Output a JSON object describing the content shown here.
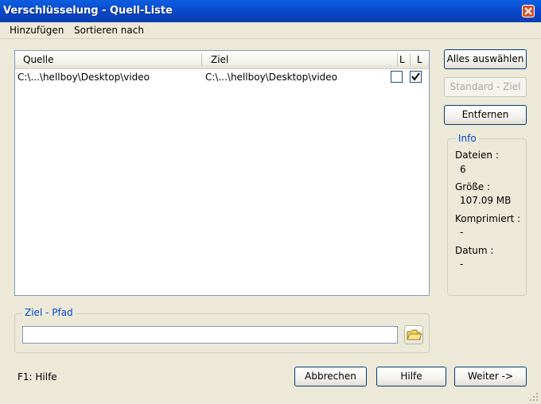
{
  "window": {
    "title": "Verschlüsselung - Quell-Liste"
  },
  "menu": [
    "Hinzufügen",
    "Sortieren nach"
  ],
  "list": {
    "columns": [
      "Quelle",
      "Ziel",
      "L",
      "L"
    ],
    "rows": [
      {
        "source": "C:\\...\\hellboy\\Desktop\\video",
        "target": "C:\\...\\hellboy\\Desktop\\video",
        "check1": false,
        "check2": true
      }
    ]
  },
  "buttons": {
    "select_all": "Alles auswählen",
    "default_target": "Standard - Ziel",
    "remove": "Entfernen",
    "cancel": "Abbrechen",
    "help": "Hilfe",
    "next": "Weiter ->"
  },
  "info": {
    "title": "Info",
    "files_label": "Dateien :",
    "files_value": "6",
    "size_label": "Größe :",
    "size_value": "107.09 MB",
    "compressed_label": "Komprimiert :",
    "compressed_value": "-",
    "date_label": "Datum :",
    "date_value": "-"
  },
  "target_path": {
    "title": "Ziel - Pfad",
    "value": ""
  },
  "status": "F1: Hilfe",
  "colors": {
    "titlebar": "#0a46c8",
    "accent_text": "#0046d5",
    "face": "#ece9d8"
  },
  "icons": {
    "close": "close-icon",
    "folder": "folder-icon",
    "check": "checkmark-icon"
  }
}
